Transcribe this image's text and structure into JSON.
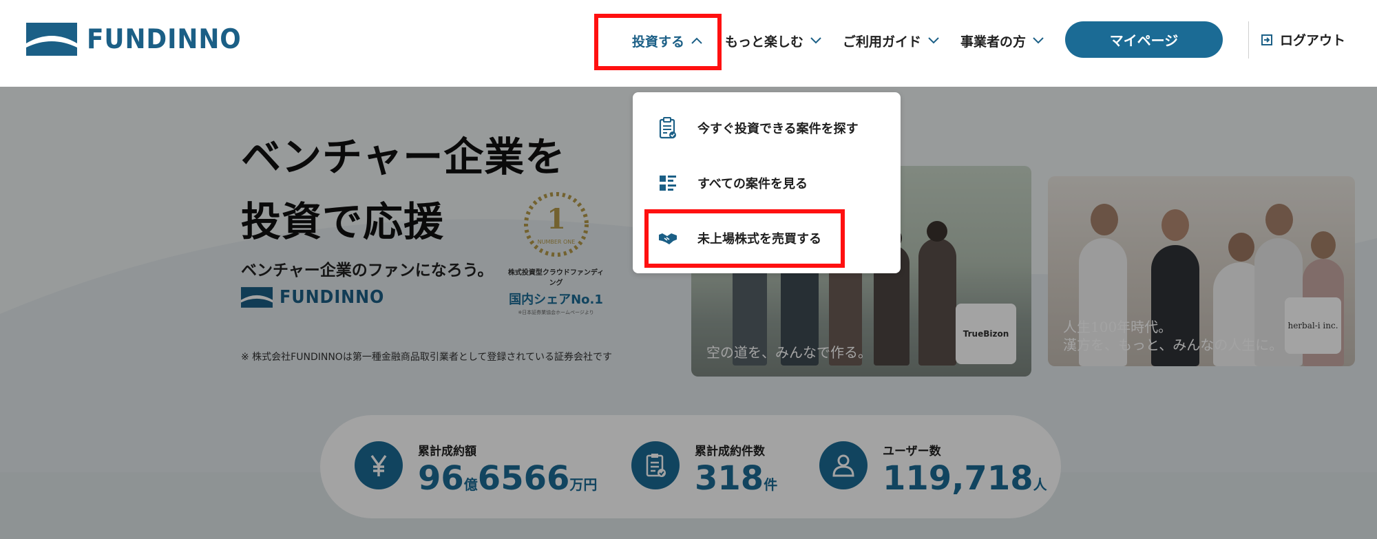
{
  "brand": {
    "name": "FUNDINNO",
    "color": "#1b5f86"
  },
  "nav": {
    "invest": "投資する",
    "more": "もっと楽しむ",
    "guide": "ご利用ガイド",
    "business": "事業者の方",
    "mypage": "マイページ",
    "logout": "ログアウト"
  },
  "dropdown": {
    "items": [
      {
        "label": "今すぐ投資できる案件を探す",
        "icon": "clipboard-check-icon"
      },
      {
        "label": "すべての案件を見る",
        "icon": "list-icon"
      },
      {
        "label": "未上場株式を売買する",
        "icon": "handshake-icon"
      }
    ]
  },
  "hero": {
    "headline_line1": "ベンチャー企業を",
    "headline_line2": "投資で応援",
    "subtext": "ベンチャー企業のファンになろう。",
    "logo_text": "FUNDINNO",
    "badge": {
      "number": "1",
      "number_text": "NUMBER ONE",
      "category": "株式投資型クラウドファンディング",
      "title": "国内シェアNo.1",
      "note": "※日本証券業協会ホームページより"
    },
    "disclaimer": "※ 株式会社FUNDINNOは第一種金融商品取引業者として登録されている証券会社です",
    "photos": [
      {
        "caption": "空の道を、みんなで作る。",
        "company": "TrueBizon"
      },
      {
        "caption_line1": "人生100年時代。",
        "caption_line2": "漢方を、もっと、みんなの人生に。",
        "company": "herbal-i inc."
      }
    ]
  },
  "stats": [
    {
      "label": "累計成約額",
      "value_major": "96",
      "unit_major": "億",
      "value_minor": "6566",
      "unit_minor": "万円",
      "icon": "yen-icon"
    },
    {
      "label": "累計成約件数",
      "value": "318",
      "unit": "件",
      "icon": "clipboard-check-icon"
    },
    {
      "label": "ユーザー数",
      "value": "119,718",
      "unit": "人",
      "icon": "user-icon"
    }
  ],
  "colors": {
    "accent": "#1b6b95",
    "highlight": "#ff1010"
  }
}
